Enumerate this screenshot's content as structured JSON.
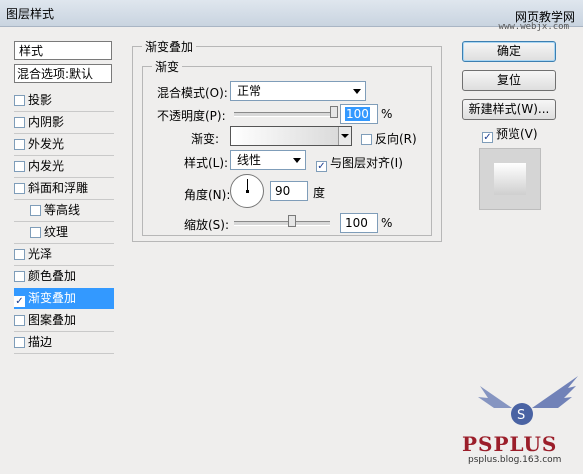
{
  "window": {
    "title": "图层样式",
    "watermark_site": "网页教学网",
    "watermark_url": "www.webjx.com"
  },
  "style_list": {
    "header": "样式",
    "blend_options": "混合选项:默认",
    "items": [
      {
        "label": "投影",
        "checked": false
      },
      {
        "label": "内阴影",
        "checked": false
      },
      {
        "label": "外发光",
        "checked": false
      },
      {
        "label": "内发光",
        "checked": false
      },
      {
        "label": "斜面和浮雕",
        "checked": false
      },
      {
        "label": "等高线",
        "checked": false,
        "sub": true
      },
      {
        "label": "纹理",
        "checked": false,
        "sub": true
      },
      {
        "label": "光泽",
        "checked": false
      },
      {
        "label": "颜色叠加",
        "checked": false
      },
      {
        "label": "渐变叠加",
        "checked": true,
        "selected": true
      },
      {
        "label": "图案叠加",
        "checked": false
      },
      {
        "label": "描边",
        "checked": false
      }
    ]
  },
  "panel": {
    "group_title": "渐变叠加",
    "sub_group_title": "渐变",
    "blend_mode_label": "混合模式(O):",
    "blend_mode_value": "正常",
    "opacity_label": "不透明度(P):",
    "opacity_value": "100",
    "opacity_fraction": 1.0,
    "percent": "%",
    "gradient_label": "渐变:",
    "reverse_label": "反向(R)",
    "reverse_checked": false,
    "style_label": "样式(L):",
    "style_value": "线性",
    "align_label": "与图层对齐(I)",
    "align_checked": true,
    "angle_label": "角度(N):",
    "angle_value": "90",
    "angle_unit": "度",
    "scale_label": "缩放(S):",
    "scale_value": "100",
    "scale_fraction": 0.6
  },
  "buttons": {
    "ok": "确定",
    "reset": "复位",
    "new_style": "新建样式(W)...",
    "preview_label": "预览(V)",
    "preview_checked": true
  },
  "logo": {
    "text": "PSPLUS",
    "url": "psplus.blog.163.com"
  },
  "colors": {
    "selection": "#3399ff",
    "dialog_bg": "#efeeed"
  }
}
